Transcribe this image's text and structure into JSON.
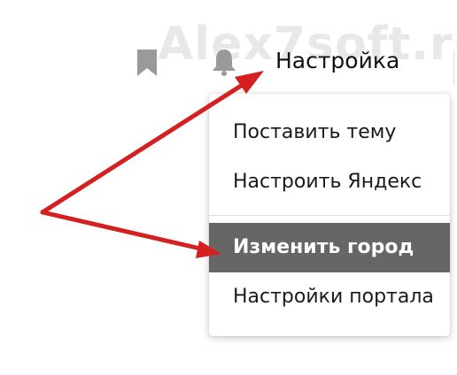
{
  "watermark": "Alex7soft.ru",
  "header": {
    "bookmark_icon": "bookmark-icon",
    "bell_icon": "bell-icon",
    "settings_label": "Настройка"
  },
  "menu": {
    "items": [
      {
        "label": "Поставить тему",
        "highlighted": false
      },
      {
        "label": "Настроить Яндекс",
        "highlighted": false
      },
      {
        "label": "Изменить город",
        "highlighted": true
      },
      {
        "label": "Настройки портала",
        "highlighted": false
      }
    ]
  },
  "colors": {
    "arrow": "#d42020",
    "highlight_bg": "#666666",
    "icon_gray": "#9a9a9a"
  }
}
